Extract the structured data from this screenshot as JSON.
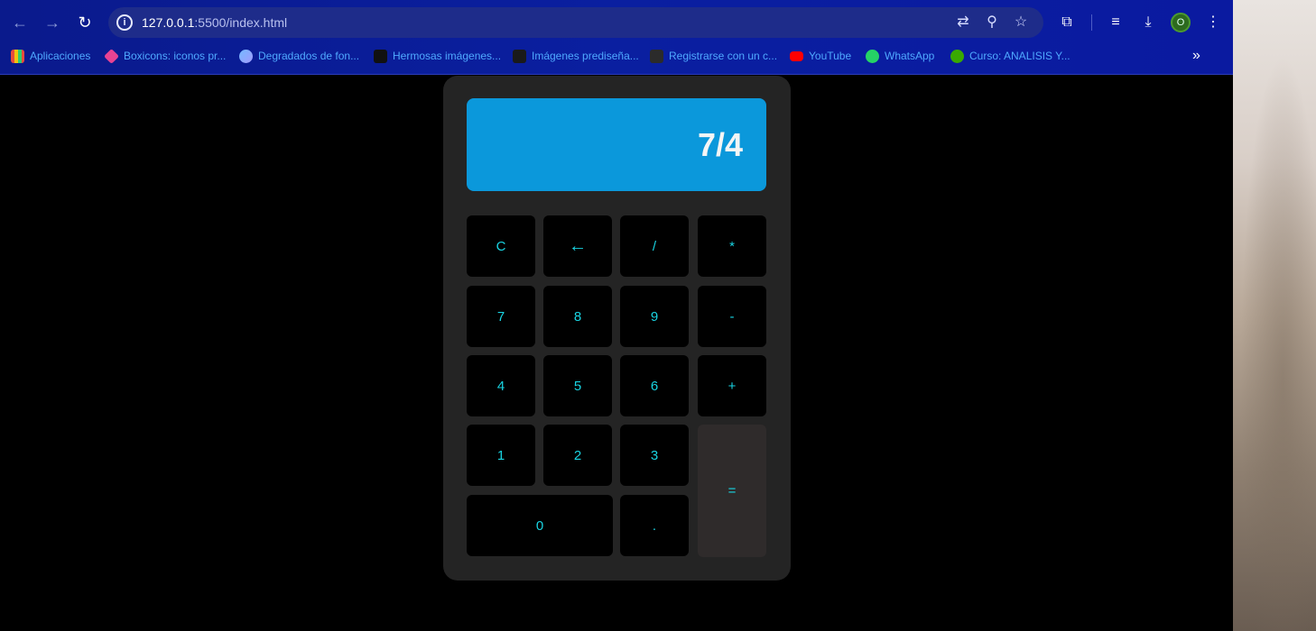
{
  "browser": {
    "url_host": "127.0.0.1",
    "url_path": ":5500/index.html",
    "profile_initial": "O",
    "bookmarks": [
      {
        "label": "Aplicaciones",
        "icon": "apps-grid-icon",
        "color": "#e74c3c"
      },
      {
        "label": "Boxicons: iconos pr...",
        "icon": "boxicons-icon",
        "color": "#e84393"
      },
      {
        "label": "Degradados de fon...",
        "icon": "gradient-icon",
        "color": "#74b9ff"
      },
      {
        "label": "Hermosas imágenes...",
        "icon": "unsplash-icon",
        "color": "#111111"
      },
      {
        "label": "Imágenes prediseña...",
        "icon": "pngtree-icon",
        "color": "#1a1a1a"
      },
      {
        "label": "Registrarse con un c...",
        "icon": "freecodecamp-icon",
        "color": "#2b2b2b"
      },
      {
        "label": "YouTube",
        "icon": "youtube-icon",
        "color": "#ff0000"
      },
      {
        "label": "WhatsApp",
        "icon": "whatsapp-icon",
        "color": "#25d366"
      },
      {
        "label": "Curso: ANALISIS Y...",
        "icon": "sena-icon",
        "color": "#39a900"
      }
    ]
  },
  "calculator": {
    "display": "7/4",
    "keys": {
      "clear": "C",
      "backspace": "←",
      "divide": "/",
      "multiply": "*",
      "seven": "7",
      "eight": "8",
      "nine": "9",
      "minus": "-",
      "four": "4",
      "five": "5",
      "six": "6",
      "plus": "+",
      "one": "1",
      "two": "2",
      "three": "3",
      "equals": "=",
      "zero": "0",
      "dot": "."
    }
  }
}
